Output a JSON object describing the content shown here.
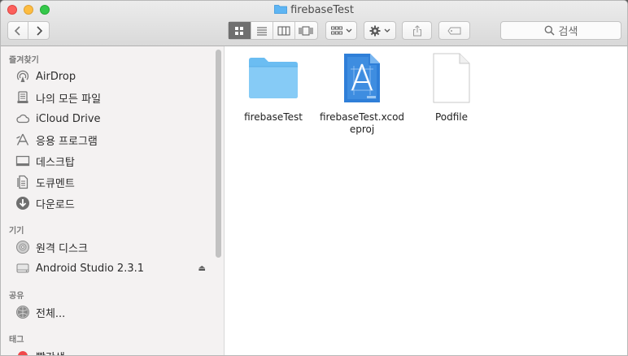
{
  "window": {
    "title": "firebaseTest"
  },
  "toolbar": {
    "search_placeholder": "검색"
  },
  "sidebar": {
    "sections": [
      {
        "label": "즐겨찾기"
      },
      {
        "label": "기기"
      },
      {
        "label": "공유"
      },
      {
        "label": "태그"
      }
    ],
    "favorites": [
      {
        "label": "AirDrop",
        "icon": "airdrop-icon"
      },
      {
        "label": "나의 모든 파일",
        "icon": "all-files-icon"
      },
      {
        "label": "iCloud Drive",
        "icon": "cloud-icon"
      },
      {
        "label": "응용 프로그램",
        "icon": "applications-icon"
      },
      {
        "label": "데스크탑",
        "icon": "desktop-icon"
      },
      {
        "label": "도큐멘트",
        "icon": "documents-icon"
      },
      {
        "label": "다운로드",
        "icon": "downloads-icon"
      }
    ],
    "devices": [
      {
        "label": "원격 디스크",
        "icon": "disc-icon"
      },
      {
        "label": "Android Studio 2.3.1",
        "icon": "drive-icon"
      }
    ],
    "shared": [
      {
        "label": "전체...",
        "icon": "network-icon"
      }
    ],
    "tags": [
      {
        "label": "빨간색",
        "color": "#f0484a"
      }
    ]
  },
  "files": [
    {
      "name": "firebaseTest",
      "icon": "folder-icon"
    },
    {
      "name": "firebaseTest.xcodeproj",
      "icon": "xcode-project-icon"
    },
    {
      "name": "Podfile",
      "icon": "document-icon"
    }
  ]
}
